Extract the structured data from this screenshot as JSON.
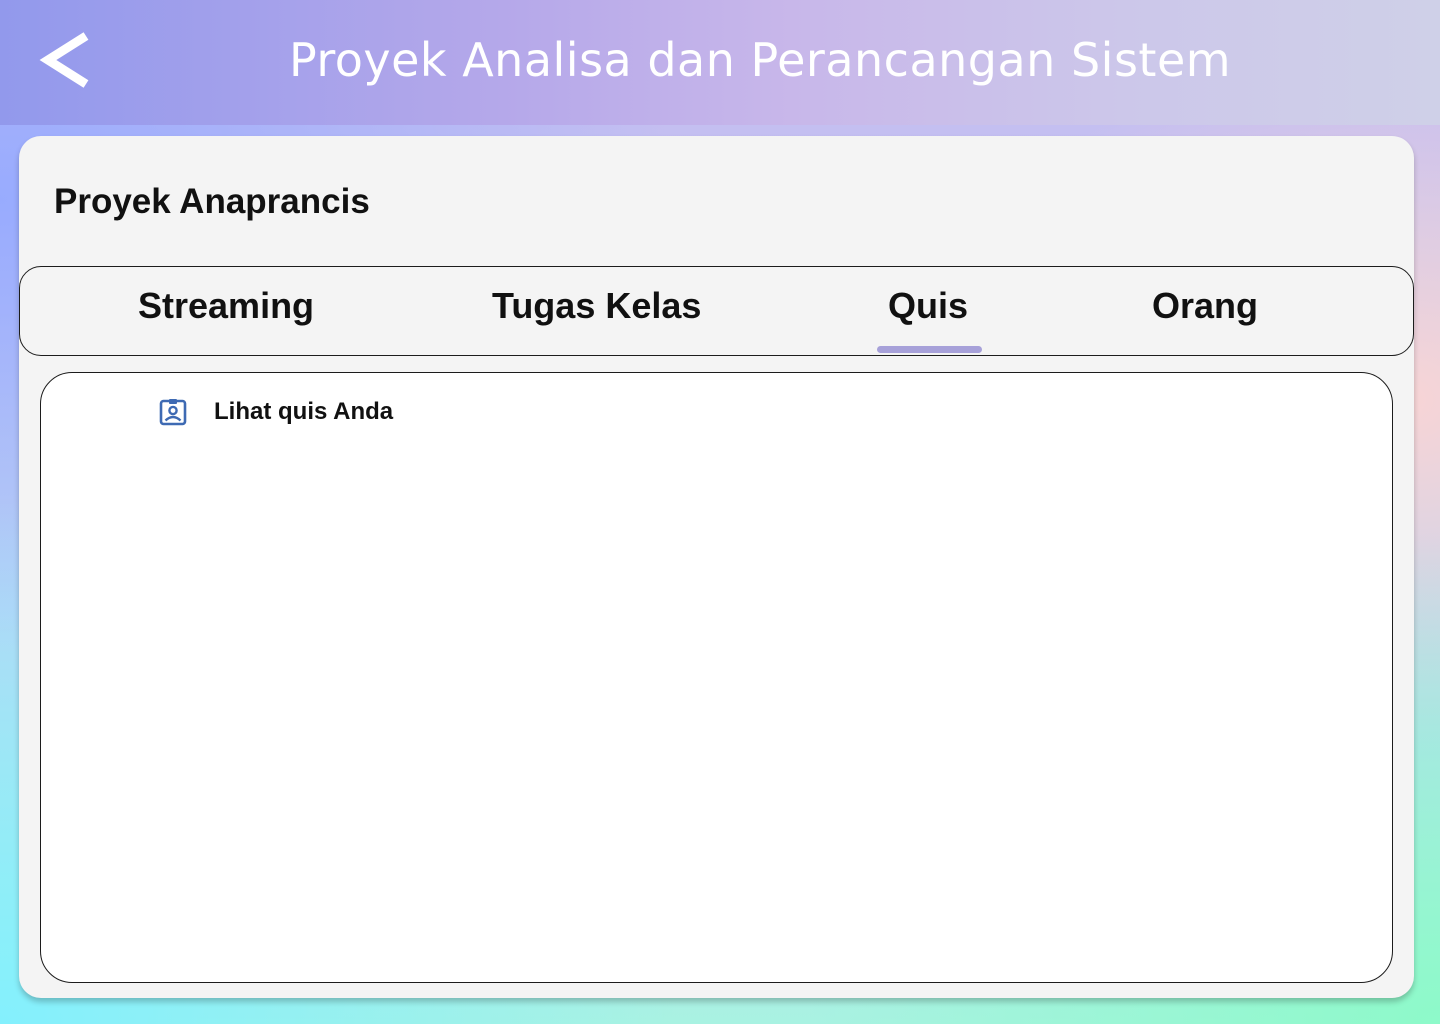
{
  "header": {
    "back_icon": "chevron-left-icon",
    "title": "Proyek Analisa dan Perancangan Sistem"
  },
  "course": {
    "name": "Proyek Anaprancis"
  },
  "tabs": [
    {
      "label": "Streaming",
      "active": false
    },
    {
      "label": "Tugas Kelas",
      "active": false
    },
    {
      "label": "Quis",
      "active": true
    },
    {
      "label": "Orang",
      "active": false
    }
  ],
  "quiz_panel": {
    "link_icon": "quiz-badge-icon",
    "link_label": "Lihat quis Anda"
  },
  "colors": {
    "header_start": "#9299ec",
    "header_end": "#cfd0e8",
    "tab_indicator": "#a7a1d9",
    "icon_blue": "#3e6ab3",
    "card_bg": "#f4f4f4"
  }
}
